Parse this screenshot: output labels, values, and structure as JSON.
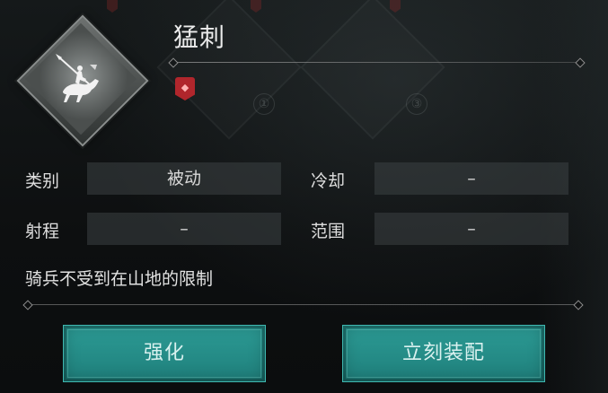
{
  "skill": {
    "name": "猛刺",
    "description": "骑兵不受到在山地的限制"
  },
  "attributes": {
    "category_label": "类别",
    "category_value": "被动",
    "cooldown_label": "冷却",
    "cooldown_value": "–",
    "range_label": "射程",
    "range_value": "–",
    "area_label": "范围",
    "area_value": "–"
  },
  "background_slots": [
    {
      "number": "①"
    },
    {
      "number": "③"
    }
  ],
  "buttons": {
    "upgrade_label": "强化",
    "equip_label": "立刻装配"
  },
  "colors": {
    "accent_teal": "#2c9b95",
    "badge_red": "#b0262c"
  },
  "icons": {
    "skill_icon": "cavalry-lancer-icon",
    "badge_icon": "red-gem-badge-icon"
  }
}
